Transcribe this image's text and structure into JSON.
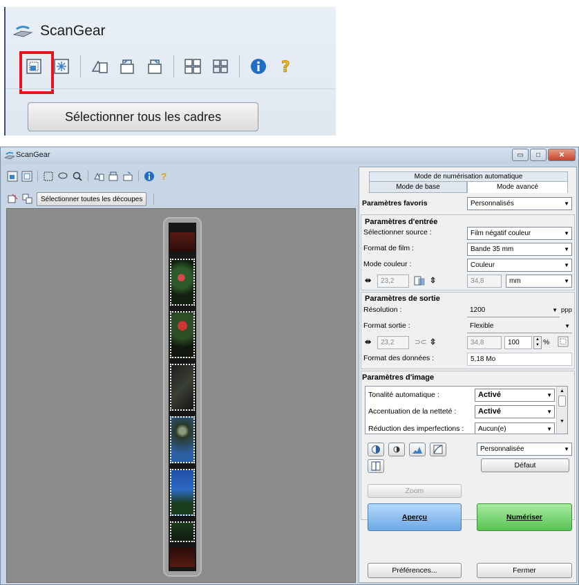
{
  "inset": {
    "title": "ScanGear",
    "select_all_frames": "Sélectionner tous les cadres"
  },
  "window": {
    "title": "ScanGear",
    "controls": {
      "minimize": "▭",
      "maximize": "□",
      "close": "✕"
    }
  },
  "left": {
    "select_all_crops": "Sélectionner toutes les découpes"
  },
  "tabs": {
    "auto_scan_mode": "Mode de numérisation automatique",
    "basic_mode": "Mode de base",
    "advanced_mode": "Mode avancé"
  },
  "favorites": {
    "label": "Paramètres favoris",
    "value": "Personnalisés"
  },
  "input": {
    "heading": "Paramètres d'entrée",
    "source_label": "Sélectionner source :",
    "source_value": "Film négatif couleur",
    "film_format_label": "Format de film :",
    "film_format_value": "Bande 35 mm",
    "color_mode_label": "Mode couleur :",
    "color_mode_value": "Couleur",
    "width": "23,2",
    "height": "34,8",
    "unit": "mm"
  },
  "output": {
    "heading": "Paramètres de sortie",
    "resolution_label": "Résolution :",
    "resolution_value": "1200",
    "resolution_unit": "ppp",
    "output_size_label": "Format sortie :",
    "output_size_value": "Flexible",
    "width": "23,2",
    "height": "34,8",
    "scale": "100",
    "scale_unit": "%",
    "data_size_label": "Format des données :",
    "data_size_value": "5,18 Mo"
  },
  "image": {
    "heading": "Paramètres d'image",
    "rows": [
      {
        "label": "Tonalité automatique :",
        "value": "Activé"
      },
      {
        "label": "Accentuation de la netteté :",
        "value": "Activé"
      },
      {
        "label": "Réduction des imperfections :",
        "value": "Aucun(e)"
      }
    ],
    "tone_preset": "Personnalisée",
    "default_button": "Défaut"
  },
  "actions": {
    "zoom": "Zoom",
    "preview": "Aperçu",
    "scan": "Numériser",
    "preferences": "Préférences...",
    "close": "Fermer"
  },
  "colors": {
    "highlight": "#e8141b",
    "preview_blue": "#6da9e6",
    "scan_green": "#58c552",
    "window_frame": "#c7d5e4",
    "preview_area": "#8c8c8c"
  }
}
